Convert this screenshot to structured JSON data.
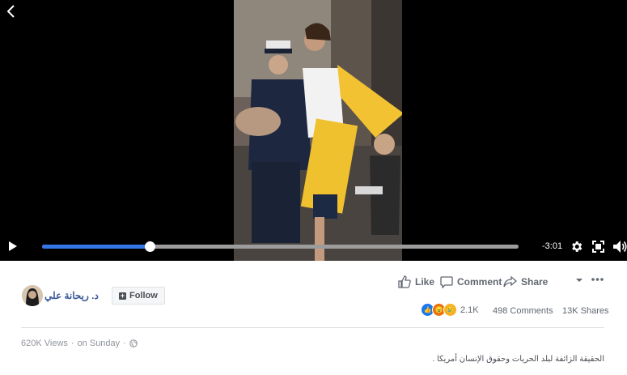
{
  "player": {
    "time_remaining": "-3:01",
    "progress_fraction": 0.226
  },
  "post": {
    "page_name": "د. ريحانة علي",
    "follow_label": "Follow",
    "actions": {
      "like": "Like",
      "comment": "Comment",
      "share": "Share"
    },
    "reaction_count": "2.1K",
    "comments": "498 Comments",
    "shares": "13K Shares",
    "views": "620K Views",
    "separator": "·",
    "posted": "on Sunday",
    "description": "الحقيقة الزائفة لبلد الحريات وحقوق الإنسان أمريكا ."
  },
  "colors": {
    "progress": "#3578e5",
    "link": "#385898",
    "like": "#1877f2",
    "angry": "#e9710f",
    "sad": "#f7b125"
  },
  "icons": [
    "back-icon",
    "play-icon",
    "gear-icon",
    "fullscreen-icon",
    "volume-icon",
    "like-icon",
    "comment-icon",
    "share-icon",
    "chevron-down-icon",
    "more-icon",
    "globe-icon"
  ]
}
